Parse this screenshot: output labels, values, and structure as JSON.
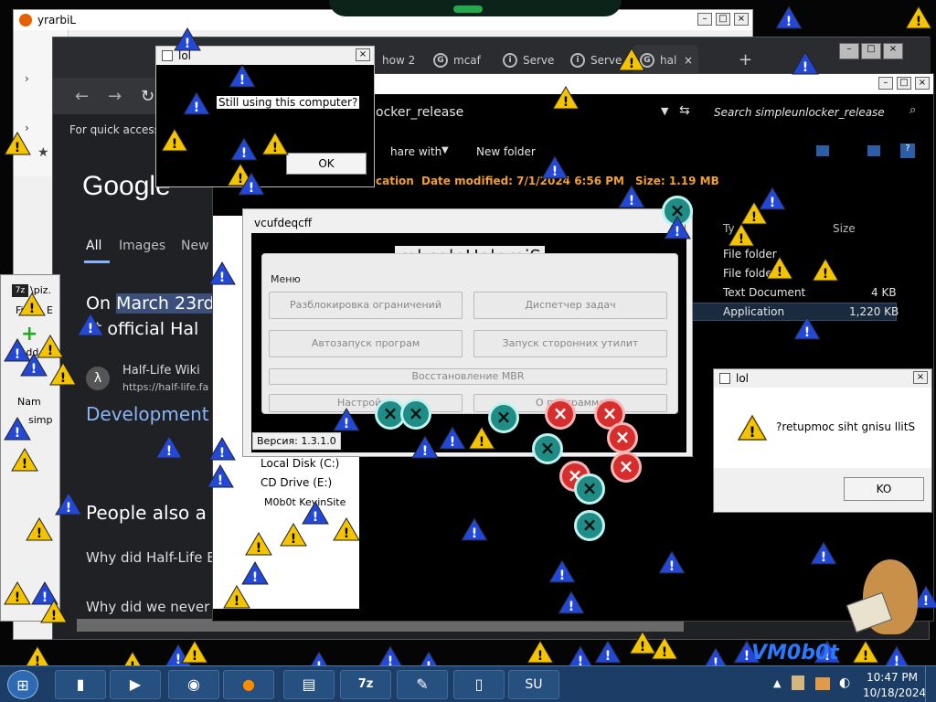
{
  "browser_back": {
    "title": "yrarbiL"
  },
  "chrome": {
    "tabs": [
      {
        "label": "how 2",
        "icon": "tab-page-icon"
      },
      {
        "label": "mcaf",
        "icon": "google-g-icon"
      },
      {
        "label": "Serve",
        "icon": "info-icon"
      },
      {
        "label": "Serve",
        "icon": "info-icon"
      },
      {
        "label": "hal",
        "icon": "google-g-icon"
      }
    ],
    "bookmarks_hint": "For quick access, p",
    "google_logo": "Google",
    "search_tabs": [
      "All",
      "Images",
      "New"
    ],
    "result_snippet_1": "On ",
    "result_snippet_1_highlight": "March 23rd",
    "result_snippet_2": "st official Hal",
    "wiki_title": "Half-Life Wiki",
    "wiki_url": "https://half-life.fa",
    "development": "Development",
    "people_also": "People also a",
    "q1": "Why did Half-Life E",
    "q2": "Why did we never"
  },
  "winrar": {
    "title": "\\piz.",
    "menu_file": "File",
    "menu_e": "E",
    "add": "Add",
    "col_name": "Nam",
    "row_short": "simp"
  },
  "explorer": {
    "folder": "ocker_release",
    "search_placeholder": "Search simpleunlocker_release",
    "share_with": "hare with",
    "new_folder": "New folder",
    "location_label": "cation",
    "date_modified": "Date modified: 7/1/2024 6:56 PM",
    "size_label": "Size: 1.19 MB",
    "col_type": "Ty",
    "col_size": "Size",
    "rows": [
      {
        "type": "File folder",
        "size": ""
      },
      {
        "type": "File folde",
        "size": ""
      },
      {
        "type": "Text Document",
        "size": "4 KB"
      },
      {
        "type": "Application",
        "size": "1,220 KB"
      }
    ],
    "nav_items": [
      "Local Disk (C:)",
      "CD Drive (E:)",
      "M0b0t KevinSite"
    ]
  },
  "unlocker": {
    "title": "vcufdeqcff",
    "app_title": "rekcolnUelpmiS",
    "menu_label": "Меню",
    "buttons": [
      "Разблокировка ограничений",
      "Диспетчер задач",
      "Автозапуск програм",
      "Запуск сторонних утилит",
      "Восстановление MBR",
      "Настройки",
      "О программе"
    ],
    "version": "Версия: 1.3.1.0"
  },
  "dialog_top": {
    "title": "lol",
    "message": "Still using this computer?",
    "ok": "OK"
  },
  "dialog_right": {
    "title": "lol",
    "message": "?retupmoc siht gnisu llitS",
    "ok": "KO"
  },
  "taskbar": {
    "time": "10:47 PM",
    "date": "10/18/2024",
    "apps": [
      "cmd",
      "media",
      "browser",
      "firefox",
      "notepad",
      "7z",
      "paint",
      "phone",
      "su"
    ]
  },
  "watermark": "VM0b0t"
}
